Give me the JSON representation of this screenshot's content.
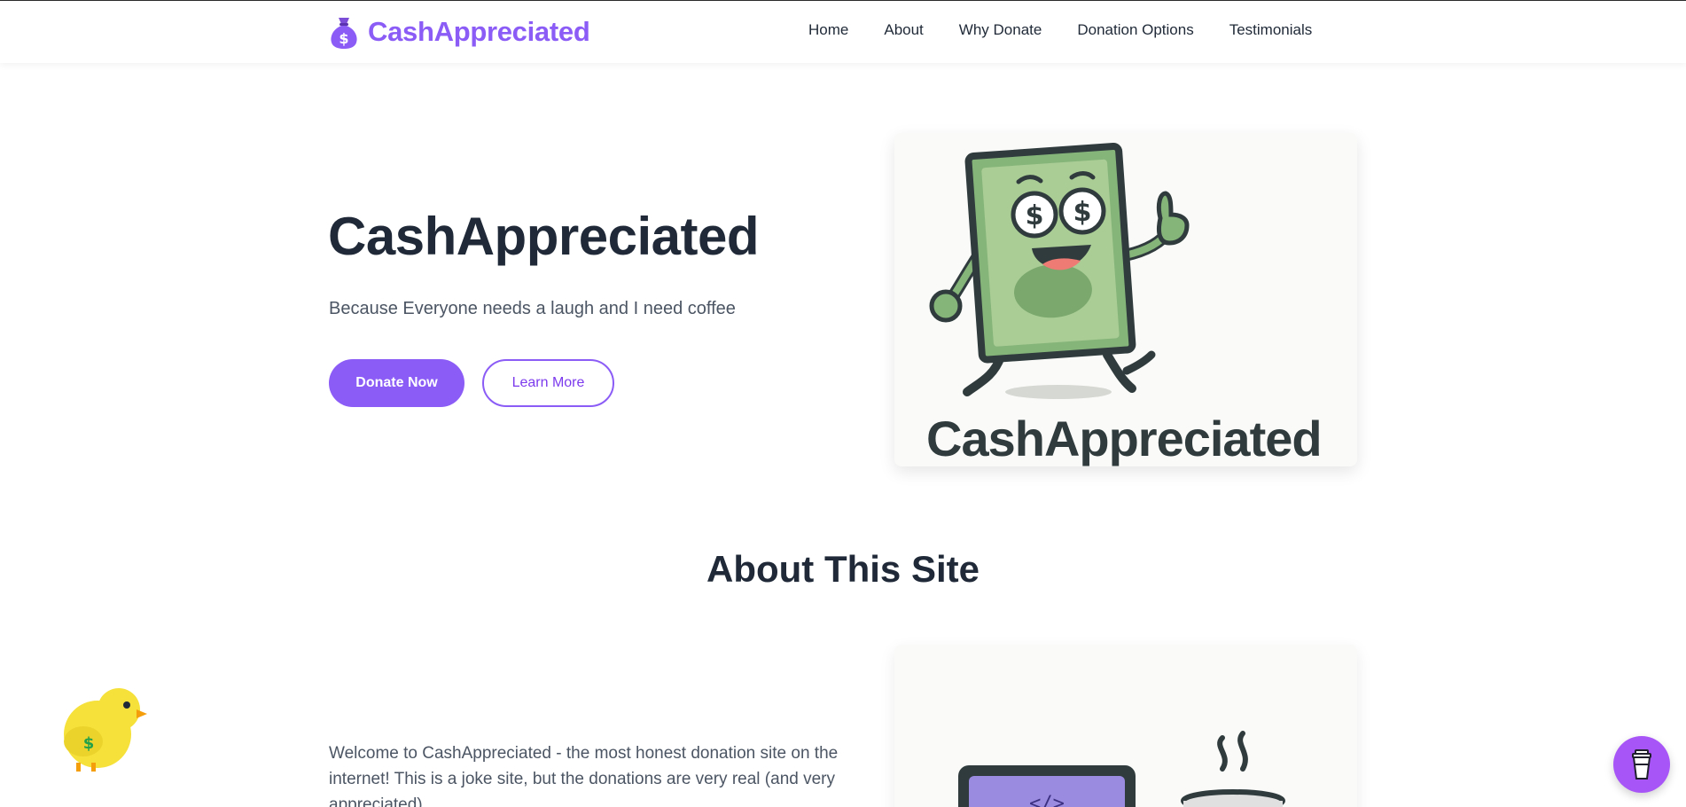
{
  "nav": {
    "brand": "CashAppreciated",
    "links": [
      "Home",
      "About",
      "Why Donate",
      "Donation Options",
      "Testimonials"
    ]
  },
  "hero": {
    "title": "CashAppreciated",
    "subtitle": "Because Everyone needs a laugh and I need coffee",
    "donate_label": "Donate Now",
    "learn_label": "Learn More",
    "image_caption": "CashAppreciated"
  },
  "about": {
    "title": "About This Site",
    "text": "Welcome to CashAppreciated - the most honest donation site on the internet! This is a joke site, but the donations are very real (and very appreciated)."
  },
  "icons": {
    "brand": "money-bag-icon",
    "mascot": "dollar-bill-mascot",
    "chick": "chick-mascot-icon",
    "coffee": "coffee-cup-icon"
  },
  "colors": {
    "accent": "#8b5cf6",
    "text": "#1f2937",
    "muted": "#4b5563",
    "bill_green": "#86b57a",
    "fab": "#a855f7"
  }
}
